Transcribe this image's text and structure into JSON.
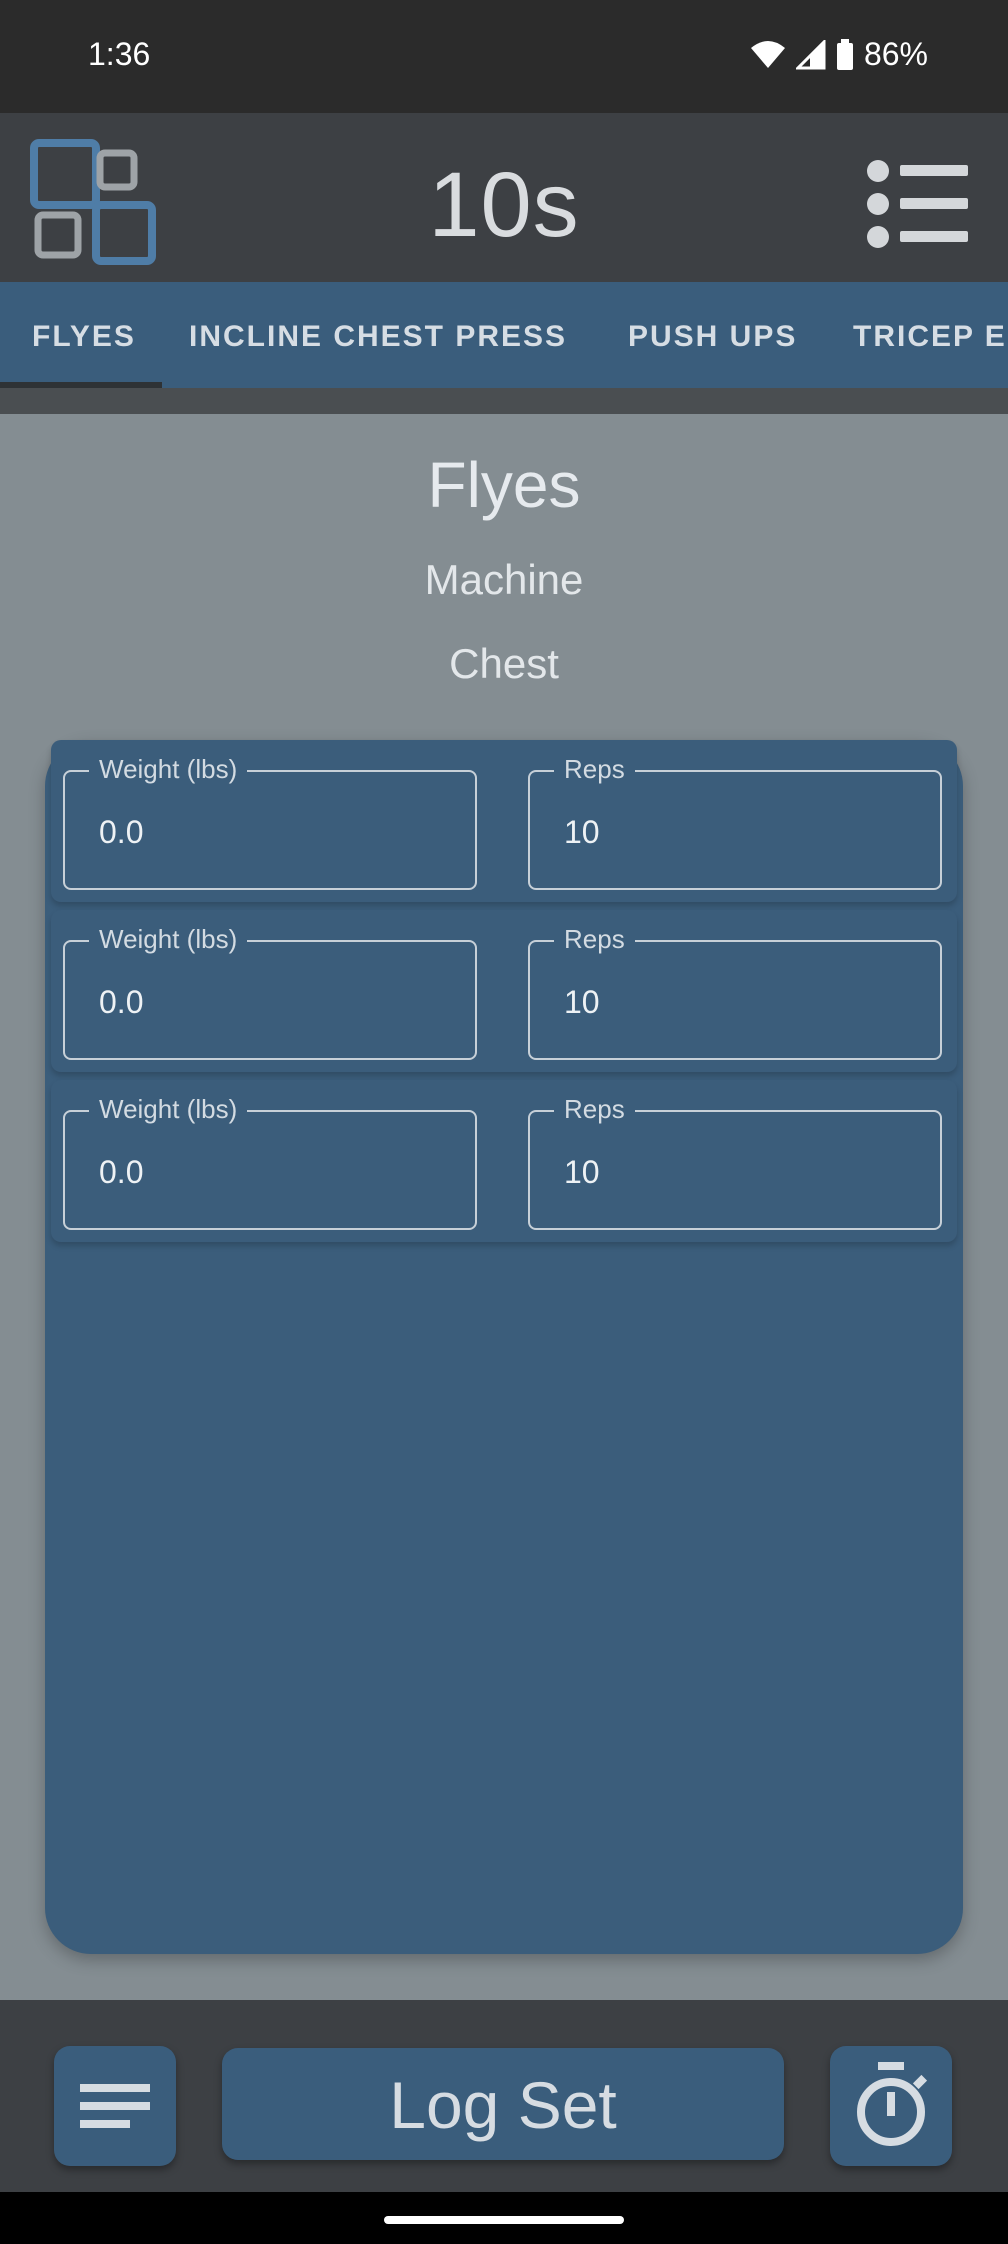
{
  "status_bar": {
    "time": "1:36",
    "battery": "86%",
    "icons": [
      "wifi-icon",
      "signal-icon",
      "battery-icon"
    ]
  },
  "app_bar": {
    "timer": "10s",
    "logo_icon": "app-logo-icon",
    "menu_icon": "list-menu-icon"
  },
  "tabs": [
    {
      "label": "FLYES",
      "selected": true
    },
    {
      "label": "INCLINE CHEST PRESS",
      "selected": false
    },
    {
      "label": "PUSH UPS",
      "selected": false
    },
    {
      "label": "TRICEP E",
      "selected": false
    }
  ],
  "exercise": {
    "name": "Flyes",
    "equipment": "Machine",
    "muscle": "Chest"
  },
  "sets": [
    {
      "weight_label": "Weight (lbs)",
      "weight": "0.0",
      "reps_label": "Reps",
      "reps": "10"
    },
    {
      "weight_label": "Weight (lbs)",
      "weight": "0.0",
      "reps_label": "Reps",
      "reps": "10"
    },
    {
      "weight_label": "Weight (lbs)",
      "weight": "0.0",
      "reps_label": "Reps",
      "reps": "10"
    }
  ],
  "bottom_bar": {
    "list_icon": "notes-list-icon",
    "log_label": "Log Set",
    "timer_icon": "stopwatch-icon"
  },
  "colors": {
    "primary": "#3a5d7c",
    "app_bar": "#3d4044",
    "background": "#848d92",
    "logo": "#4f7da7"
  }
}
